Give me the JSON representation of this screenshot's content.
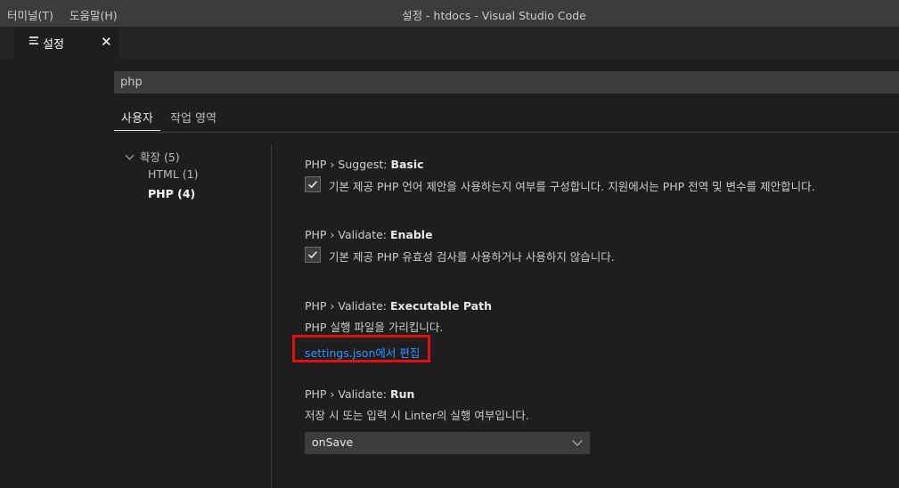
{
  "titlebar": {
    "menus": [
      "터미널(T)",
      "도움말(H)"
    ],
    "window_title": "설정 - htdocs - Visual Studio Code"
  },
  "tab": {
    "label": "설정",
    "close_glyph": "✕",
    "icon": "settings-editor-icon"
  },
  "search": {
    "value": "php"
  },
  "scope_tabs": [
    "사용자",
    "작업 영역"
  ],
  "toc": {
    "extensions": "확장 (5)",
    "html": "HTML (1)",
    "php": "PHP (4)"
  },
  "settings": [
    {
      "prefix": "PHP › Suggest: ",
      "name": "Basic",
      "checked": true,
      "description": "기본 제공 PHP 언어 제안을 사용하는지 여부를 구성합니다. 지원에서는 PHP 전역 및 변수를 제안합니다."
    },
    {
      "prefix": "PHP › Validate: ",
      "name": "Enable",
      "checked": true,
      "description": "기본 제공 PHP 유효성 검사를 사용하거나 사용하지 않습니다."
    },
    {
      "prefix": "PHP › Validate: ",
      "name": "Executable Path",
      "description": "PHP 실행 파일을 가리킵니다.",
      "link": "settings.json에서 편집"
    },
    {
      "prefix": "PHP › Validate: ",
      "name": "Run",
      "description": "저장 시 또는 입력 시 Linter의 실행 여부입니다.",
      "selected": "onSave"
    }
  ],
  "colors": {
    "link": "#3794ff",
    "highlight_box": "#e01010",
    "background": "#1e1e1e"
  }
}
